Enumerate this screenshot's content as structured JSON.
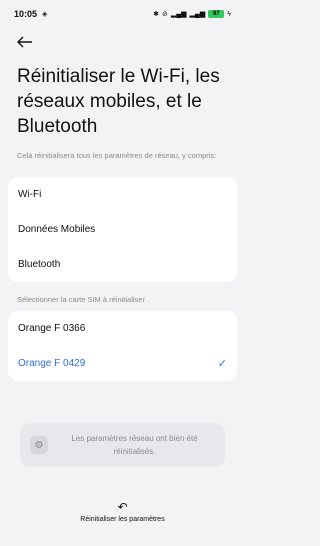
{
  "status_bar": {
    "time": "10:05",
    "battery": "97"
  },
  "page_title": "Réinitialiser le Wi-Fi, les réseaux mobiles, et le Bluetooth",
  "reset_section": {
    "label": "Cela réinitialisera tous les paramètres de réseau, y compris:",
    "items": [
      "Wi-Fi",
      "Données Mobiles",
      "Bluetooth"
    ]
  },
  "sim_section": {
    "label": "Sélectionner la carte SIM à réinitialiser",
    "items": [
      {
        "label": "Orange F 0366",
        "selected": false
      },
      {
        "label": "Orange F 0429",
        "selected": true
      }
    ]
  },
  "toast": {
    "message": "Les paramètres réseau ont bien été réinitialisés."
  },
  "reset_button": {
    "label": "Réinitialiser les paramètres"
  },
  "colors": {
    "accent": "#2f6fd6",
    "background": "#f3f3f6",
    "card": "#ffffff"
  }
}
